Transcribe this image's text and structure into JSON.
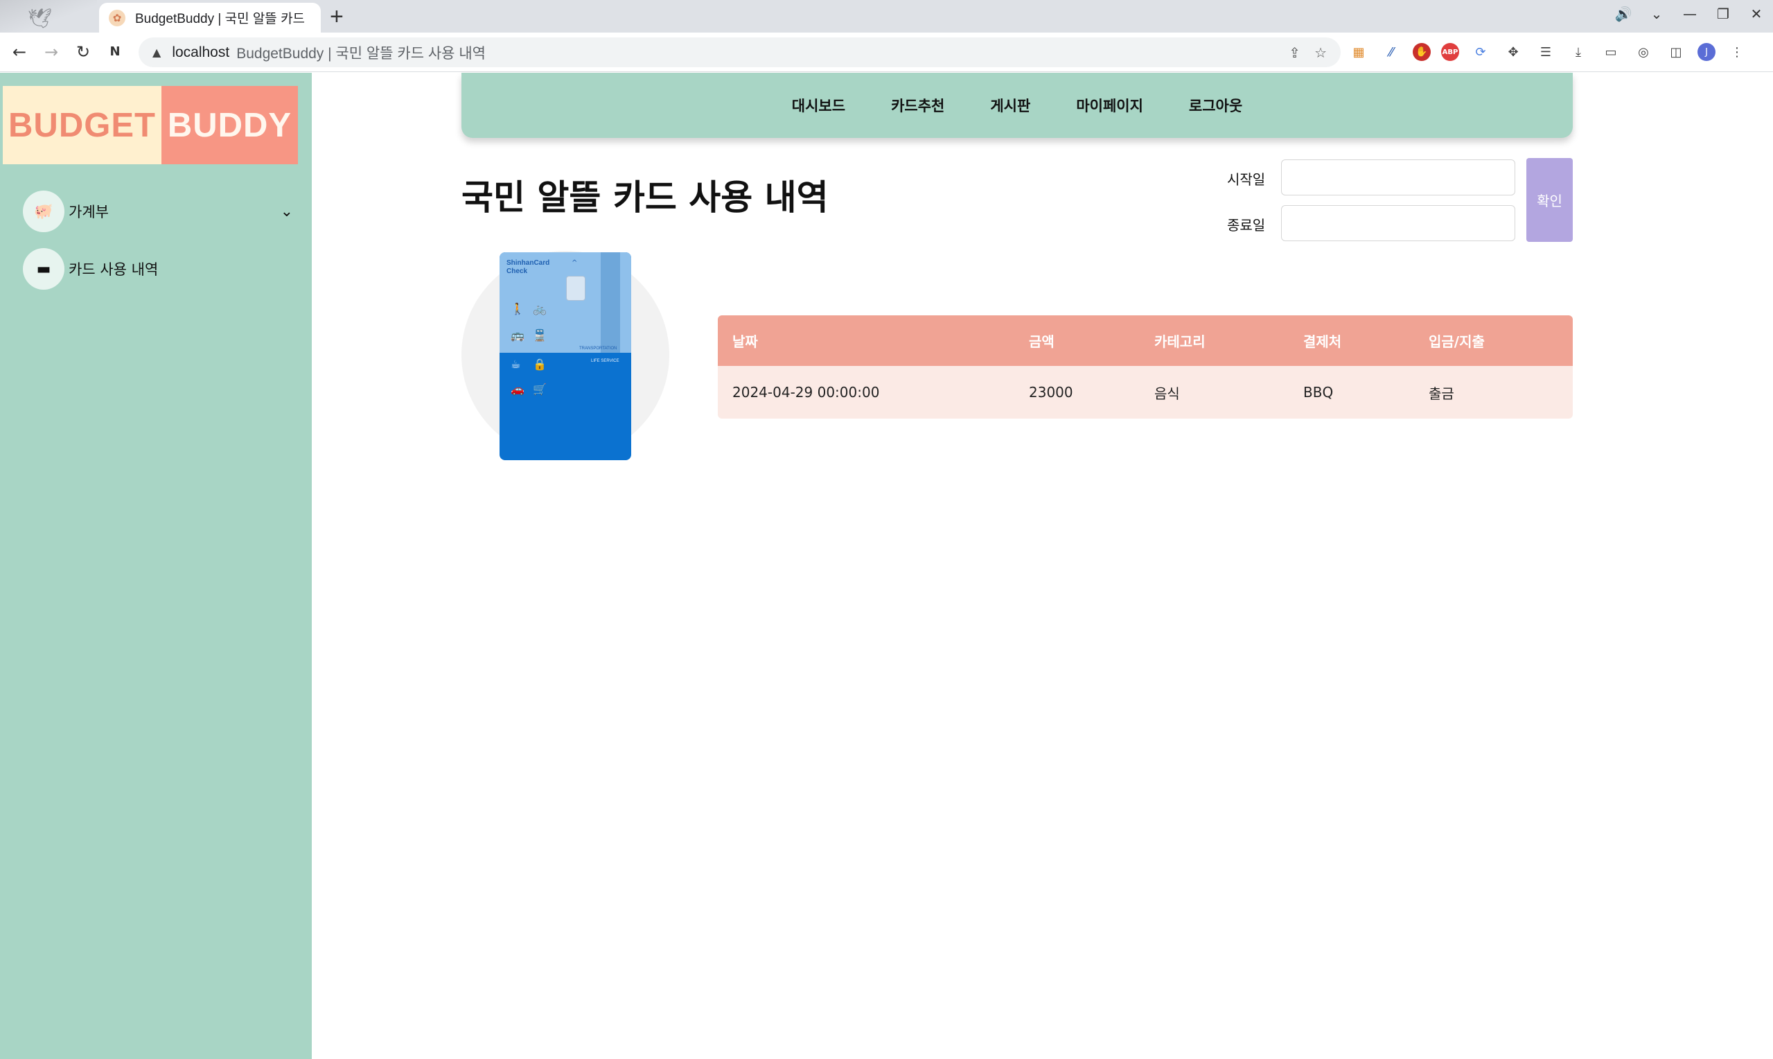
{
  "browser": {
    "tab_title": "BudgetBuddy | 국민 알뜰 카드",
    "url_host": "localhost",
    "url_title": "BudgetBuddy | 국민 알뜰 카드 사용 내역",
    "profile_initial": "J",
    "abp_label": "ABP"
  },
  "sidebar": {
    "logo_part1": "BUDGET",
    "logo_part2": "BUDDY",
    "items": [
      {
        "label": "가계부",
        "icon": "piggy-bank-icon"
      },
      {
        "label": "카드 사용 내역",
        "icon": "credit-card-icon"
      }
    ]
  },
  "topnav": {
    "items": [
      "대시보드",
      "카드추천",
      "게시판",
      "마이페이지",
      "로그아웃"
    ]
  },
  "main": {
    "title": "국민 알뜰 카드 사용 내역",
    "start_label": "시작일",
    "end_label": "종료일",
    "confirm_label": "확인",
    "start_value": "",
    "end_value": ""
  },
  "card": {
    "brand_line1": "ShinhanCard",
    "brand_line2": "Check",
    "transport_label": "TRANSPORTATION",
    "life_label": "LIFE SERVICE"
  },
  "table": {
    "columns": [
      "날짜",
      "금액",
      "카테고리",
      "결제처",
      "입금/지출"
    ],
    "rows": [
      [
        "2024-04-29 00:00:00",
        "23000",
        "음식",
        "BBQ",
        "출금"
      ]
    ]
  },
  "colors": {
    "sidebar_bg": "#a8d5c5",
    "logo_left_bg": "#fff0cf",
    "logo_right_bg": "#f79684",
    "table_header": "#f0a394",
    "table_row": "#fbeae5",
    "confirm_button": "#b3a6e0"
  }
}
